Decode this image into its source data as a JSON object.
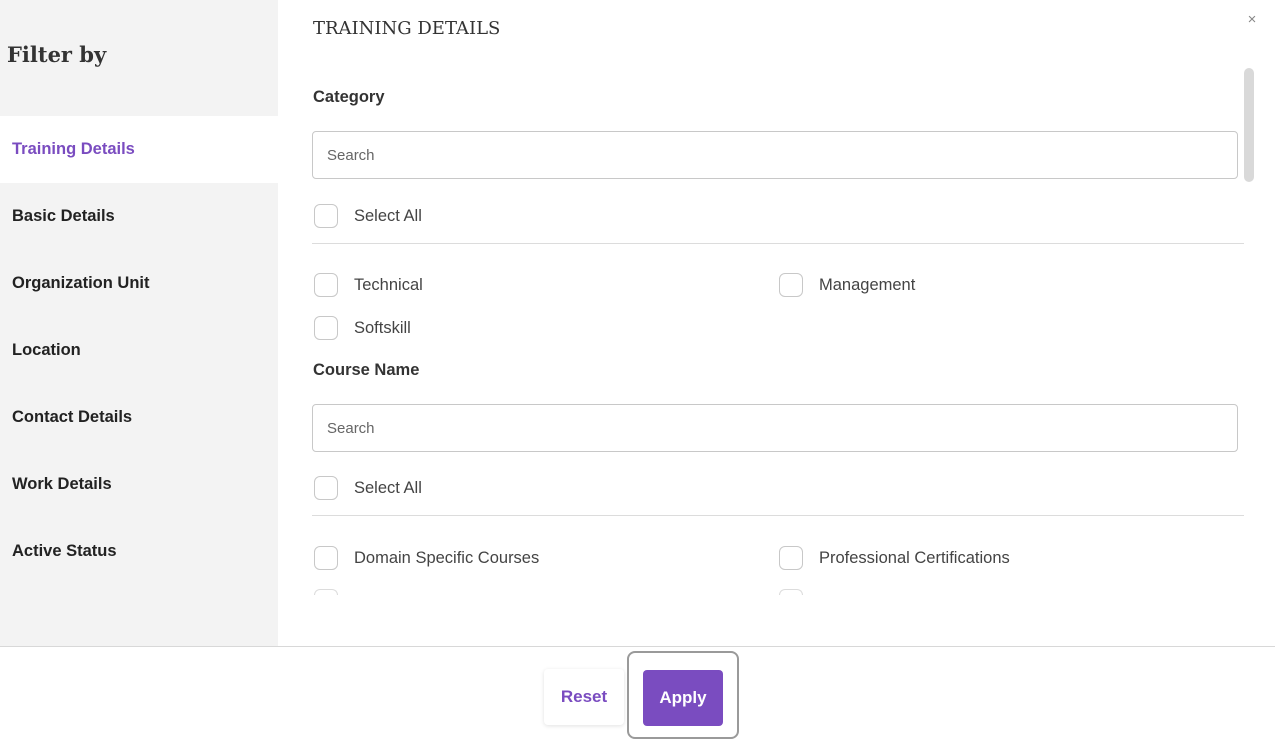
{
  "sidebar": {
    "title": "Filter by",
    "items": [
      {
        "label": "Training Details",
        "active": true
      },
      {
        "label": "Basic Details"
      },
      {
        "label": "Organization Unit"
      },
      {
        "label": "Location"
      },
      {
        "label": "Contact Details"
      },
      {
        "label": "Work Details"
      },
      {
        "label": "Active Status"
      }
    ]
  },
  "main": {
    "title": "TRAINING DETAILS",
    "close_icon": "×",
    "category": {
      "label": "Category",
      "search_placeholder": "Search",
      "select_all": "Select All",
      "options": [
        "Technical",
        "Management",
        "Softskill"
      ]
    },
    "course": {
      "label": "Course Name",
      "search_placeholder": "Search",
      "select_all": "Select All",
      "options": [
        "Domain Specific Courses",
        "Professional Certifications"
      ]
    }
  },
  "footer": {
    "reset_label": "Reset",
    "apply_label": "Apply"
  },
  "colors": {
    "accent": "#7a4cc0",
    "sidebar_bg": "#f3f3f3"
  }
}
